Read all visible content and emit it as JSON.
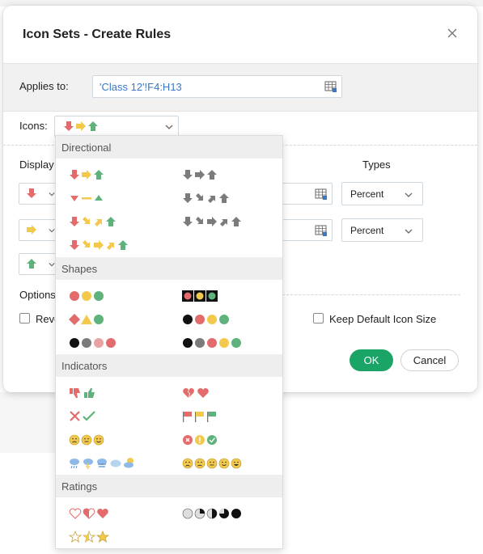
{
  "dialog": {
    "title": "Icon Sets - Create Rules",
    "applies_to_label": "Applies to:",
    "applies_to_value": "'Class 12'!F4:H13",
    "icons_label": "Icons:",
    "display_label": "Display",
    "types_label": "Types",
    "rows": [
      {
        "icon": "arrow-down-red",
        "type": "Percent"
      },
      {
        "icon": "arrow-right-yellow",
        "type": "Percent"
      },
      {
        "icon": "arrow-up-green"
      }
    ],
    "options_label": "Options",
    "reverse_label_partial": "Reve",
    "keep_default_label": "Keep Default Icon Size",
    "ok_label": "OK",
    "cancel_label": "Cancel",
    "colors": {
      "accent": "#1aa566",
      "link": "#3b77c4",
      "red": "#e36b6b",
      "yellow": "#f2c94c",
      "green": "#5fb27c",
      "gray": "#7b7b7b"
    }
  },
  "dropdown": {
    "sections": [
      {
        "name": "Directional"
      },
      {
        "name": "Shapes"
      },
      {
        "name": "Indicators"
      },
      {
        "name": "Ratings"
      }
    ]
  },
  "icons": {
    "close": "close-icon",
    "range": "range-select-icon",
    "chevron": "chevron-down-icon"
  }
}
